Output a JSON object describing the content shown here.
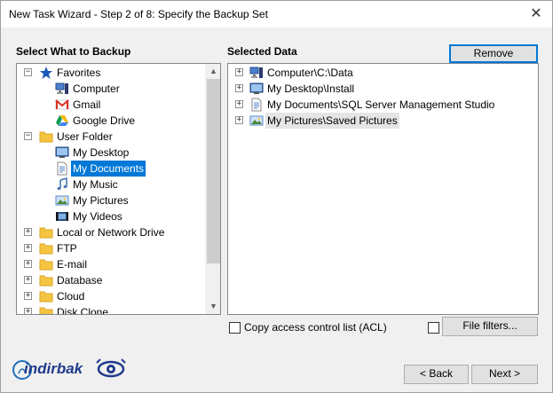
{
  "window": {
    "title": "New Task Wizard - Step 2 of 8: Specify the Backup Set"
  },
  "left": {
    "heading": "Select What to Backup",
    "items": [
      {
        "label": "Favorites",
        "icon": "star-icon",
        "expander": "−"
      },
      {
        "label": "Computer",
        "icon": "computer-icon"
      },
      {
        "label": "Gmail",
        "icon": "gmail-icon"
      },
      {
        "label": "Google Drive",
        "icon": "google-drive-icon"
      },
      {
        "label": "User Folder",
        "icon": "folder-icon",
        "expander": "−"
      },
      {
        "label": "My Desktop",
        "icon": "desktop-icon"
      },
      {
        "label": "My Documents",
        "icon": "document-icon"
      },
      {
        "label": "My Music",
        "icon": "music-icon"
      },
      {
        "label": "My Pictures",
        "icon": "picture-icon"
      },
      {
        "label": "My Videos",
        "icon": "video-icon"
      },
      {
        "label": "Local or Network Drive",
        "icon": "folder-icon",
        "expander": "+"
      },
      {
        "label": "FTP",
        "icon": "folder-icon",
        "expander": "+"
      },
      {
        "label": "E-mail",
        "icon": "folder-icon",
        "expander": "+"
      },
      {
        "label": "Database",
        "icon": "folder-icon",
        "expander": "+"
      },
      {
        "label": "Cloud",
        "icon": "folder-icon",
        "expander": "+"
      },
      {
        "label": "Disk Clone",
        "icon": "folder-icon",
        "expander": "+"
      }
    ]
  },
  "right": {
    "heading": "Selected Data",
    "remove_label": "Remove",
    "items": [
      {
        "label": "Computer\\C:\\Data",
        "icon": "computer-icon",
        "expander": "+"
      },
      {
        "label": "My Desktop\\Install",
        "icon": "desktop-icon",
        "expander": "+"
      },
      {
        "label": "My Documents\\SQL Server Management Studio",
        "icon": "document-icon",
        "expander": "+"
      },
      {
        "label": "My Pictures\\Saved Pictures",
        "icon": "picture-icon",
        "expander": "+"
      }
    ]
  },
  "options": {
    "acl_label": "Copy access control list (ACL)",
    "acl_checked": false,
    "filters_checked": false,
    "file_filters_label": "File filters..."
  },
  "footer": {
    "logo_text": "indirbak",
    "back_label": "< Back",
    "next_label": "Next >"
  },
  "colors": {
    "selection": "#0078d7",
    "folder": "#f5c542",
    "star": "#1e5bb8"
  }
}
